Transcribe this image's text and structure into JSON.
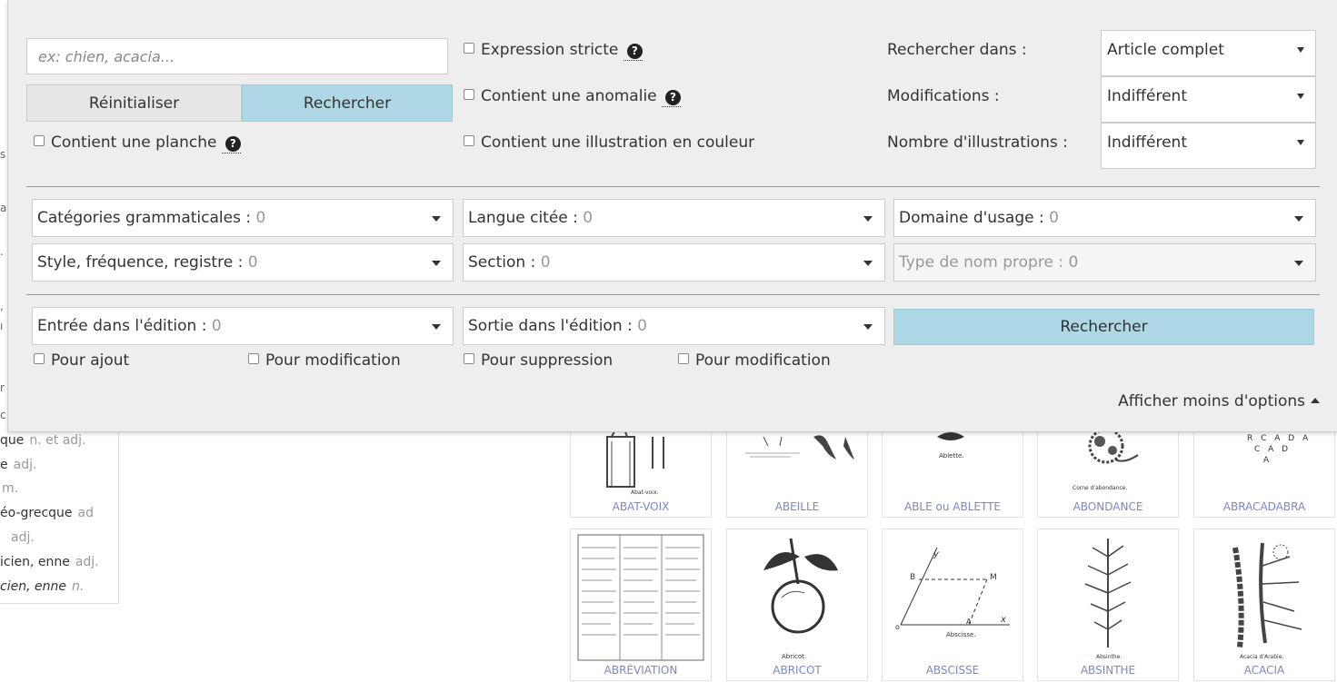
{
  "background_list": {
    "rows": [
      {
        "word": "que",
        "pos": "n. et adj.",
        "italic": false
      },
      {
        "word": "e",
        "pos": "adj.",
        "italic": false
      },
      {
        "word": "",
        "pos": "m.",
        "italic": false
      },
      {
        "word": "éo-grecque",
        "pos": "ad",
        "italic": false
      },
      {
        "word": "",
        "pos": "adj.",
        "italic": false
      },
      {
        "word": "icien, enne",
        "pos": "adj.",
        "italic": false
      },
      {
        "word": "cien, enne",
        "pos": "n.",
        "italic": true
      }
    ],
    "fragments": [
      "s",
      "a",
      ".",
      ",",
      "ı",
      "r",
      "c"
    ]
  },
  "thumbnails": [
    {
      "label": "ABAT-VOIX",
      "caption": "Abat-voix."
    },
    {
      "label": "ABEILLE",
      "caption": ""
    },
    {
      "label": "ABLE ou ABLETTE",
      "caption": "Ablette."
    },
    {
      "label": "ABONDANCE",
      "caption": "Corne d'abondance."
    },
    {
      "label": "ABRACADABRA",
      "caption": "C A D"
    },
    {
      "label": "ABRÉVIATION",
      "caption": ""
    },
    {
      "label": "ABRICOT",
      "caption": "Abricot."
    },
    {
      "label": "ABSCISSE",
      "caption": "Abscisse."
    },
    {
      "label": "ABSINTHE",
      "caption": "Absinthe."
    },
    {
      "label": "ACACIA",
      "caption": "Acacia d'Arabie."
    }
  ],
  "search": {
    "placeholder": "ex: chien, acacia...",
    "reset_label": "Réinitialiser",
    "search_label": "Rechercher",
    "search_bottom_label": "Rechercher",
    "show_less_label": "Afficher moins d'options"
  },
  "checkboxes": {
    "strict": "Expression stricte",
    "anomaly": "Contient une anomalie",
    "plate": "Contient une planche",
    "color": "Contient une illustration en couleur",
    "add": "Pour ajout",
    "modify_in": "Pour modification",
    "delete": "Pour suppression",
    "modify_out": "Pour modification"
  },
  "selects": {
    "search_in": {
      "label": "Rechercher dans :",
      "value": "Article complet"
    },
    "modifications": {
      "label": "Modifications :",
      "value": "Indifférent"
    },
    "illustrations": {
      "label": "Nombre d'illustrations :",
      "value": "Indifférent"
    }
  },
  "dropdowns": {
    "grammatical": {
      "label": "Catégories grammaticales :",
      "count": "0"
    },
    "language": {
      "label": "Langue citée :",
      "count": "0"
    },
    "domain": {
      "label": "Domaine d'usage :",
      "count": "0"
    },
    "style": {
      "label": "Style, fréquence, registre :",
      "count": "0"
    },
    "section": {
      "label": "Section :",
      "count": "0"
    },
    "proper_name": {
      "label": "Type de nom propre :",
      "count": "0"
    },
    "entry_edition": {
      "label": "Entrée dans l'édition :",
      "count": "0"
    },
    "exit_edition": {
      "label": "Sortie dans l'édition :",
      "count": "0"
    }
  },
  "colors": {
    "accent": "#aed8e6",
    "panel_bg": "#eeeeee",
    "link": "#7a88c6"
  }
}
